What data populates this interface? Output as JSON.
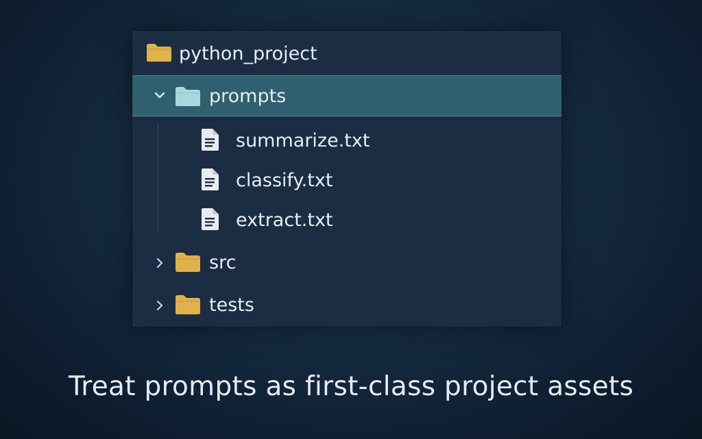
{
  "tree": {
    "root": {
      "label": "python_project",
      "icon": "folder-icon"
    },
    "items": [
      {
        "label": "prompts",
        "type": "folder",
        "expanded": true,
        "selected": true,
        "icon": "folder-icon"
      },
      {
        "label": "summarize.txt",
        "type": "file",
        "icon": "text-file-icon"
      },
      {
        "label": "classify.txt",
        "type": "file",
        "icon": "text-file-icon"
      },
      {
        "label": "extract.txt",
        "type": "file",
        "icon": "text-file-icon"
      },
      {
        "label": "src",
        "type": "folder",
        "expanded": false,
        "icon": "folder-icon"
      },
      {
        "label": "tests",
        "type": "folder",
        "expanded": false,
        "icon": "folder-icon"
      }
    ]
  },
  "caption": "Treat prompts as first-class project assets",
  "colors": {
    "folder": "#e0b24c",
    "selected_folder": "#a8d8dc",
    "selection": "#2f6070",
    "panel": "#1a2d42",
    "file": "#e8ecf0"
  }
}
